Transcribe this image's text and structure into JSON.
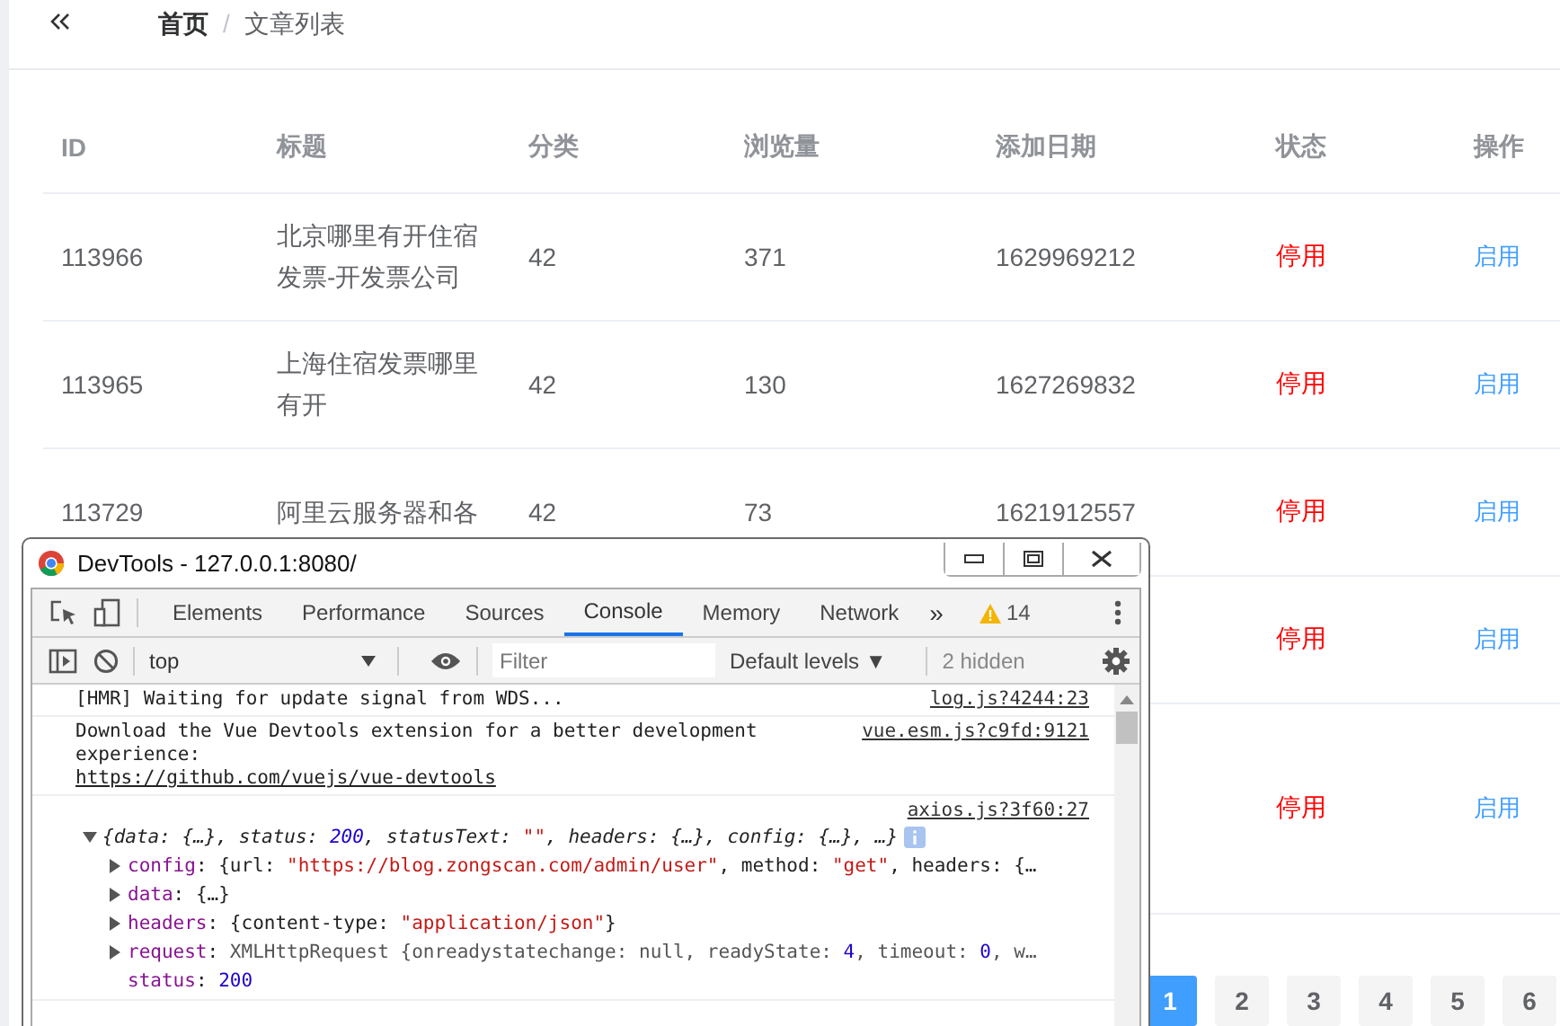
{
  "breadcrumb": [
    {
      "label": "首页",
      "current": false
    },
    {
      "label": "文章列表",
      "current": true
    }
  ],
  "breadcrumb_separator": "/",
  "table": {
    "columns": [
      "ID",
      "标题",
      "分类",
      "浏览量",
      "添加日期",
      "状态",
      "操作"
    ],
    "rows": [
      {
        "id": "113966",
        "title": "北京哪里有开住宿发票-开发票公司",
        "category": "42",
        "views": "371",
        "date": "1629969212",
        "status": "停用",
        "action": "启用"
      },
      {
        "id": "113965",
        "title": "上海住宿发票哪里有开",
        "category": "42",
        "views": "130",
        "date": "1627269832",
        "status": "停用",
        "action": "启用"
      },
      {
        "id": "113729",
        "title": "阿里云服务器和各",
        "category": "42",
        "views": "73",
        "date": "1621912557",
        "status": "停用",
        "action": "启用"
      },
      {
        "status": "停用",
        "action": "启用"
      },
      {
        "status": "停用",
        "action": "启用"
      }
    ]
  },
  "pagination": [
    {
      "label": "1",
      "selected": true
    },
    {
      "label": "2",
      "selected": false
    },
    {
      "label": "3",
      "selected": false
    },
    {
      "label": "4",
      "selected": false
    },
    {
      "label": "5",
      "selected": false
    },
    {
      "label": "6",
      "selected": false
    }
  ],
  "devtools": {
    "title": "DevTools - 127.0.0.1:8080/",
    "tabs": [
      {
        "label": "Elements",
        "selected": false
      },
      {
        "label": "Performance",
        "selected": false
      },
      {
        "label": "Sources",
        "selected": false
      },
      {
        "label": "Console",
        "selected": true
      },
      {
        "label": "Memory",
        "selected": false
      },
      {
        "label": "Network",
        "selected": false
      }
    ],
    "more_tabs": "»",
    "warnings": "14",
    "context": "top",
    "filter_placeholder": "Filter",
    "levels": "Default levels ▼",
    "hidden": "2 hidden",
    "messages": [
      {
        "kind": "log",
        "text": "[HMR] Waiting for update signal from WDS...",
        "source": "log.js?4244:23"
      },
      {
        "kind": "log",
        "text": "Download the Vue Devtools extension for a better development experience:",
        "link": "https://github.com/vuejs/vue-devtools",
        "source": "vue.esm.js?c9fd:9121"
      },
      {
        "kind": "object",
        "source": "axios.js?3f60:27",
        "summary": [
          {
            "t": "{data: {…}, status: ",
            "kind": "plain"
          },
          {
            "t": "200",
            "kind": "number"
          },
          {
            "t": ", statusText: ",
            "kind": "plain"
          },
          {
            "t": "\"\"",
            "kind": "string"
          },
          {
            "t": ", headers: {…}, config: {…}, …}",
            "kind": "plain"
          }
        ],
        "props": [
          {
            "key": "config",
            "expandable": true,
            "value": [
              {
                "t": ": ",
                "kind": "plain"
              },
              {
                "t": "{url: ",
                "kind": "plain"
              },
              {
                "t": "\"https://blog.zongscan.com/admin/user\"",
                "kind": "string"
              },
              {
                "t": ", method: ",
                "kind": "plain"
              },
              {
                "t": "\"get\"",
                "kind": "string"
              },
              {
                "t": ", headers: {…",
                "kind": "plain"
              }
            ]
          },
          {
            "key": "data",
            "expandable": true,
            "value": [
              {
                "t": ": ",
                "kind": "plain"
              },
              {
                "t": "{…}",
                "kind": "plain"
              }
            ]
          },
          {
            "key": "headers",
            "expandable": true,
            "value": [
              {
                "t": ": ",
                "kind": "plain"
              },
              {
                "t": "{content-type: ",
                "kind": "plain"
              },
              {
                "t": "\"application/json\"",
                "kind": "string"
              },
              {
                "t": "}",
                "kind": "plain"
              }
            ]
          },
          {
            "key": "request",
            "expandable": true,
            "value": [
              {
                "t": ": ",
                "kind": "plain"
              },
              {
                "t": "XMLHttpRequest {onreadystatechange: null, readyState: ",
                "kind": "grey"
              },
              {
                "t": "4",
                "kind": "number"
              },
              {
                "t": ", timeout: ",
                "kind": "grey"
              },
              {
                "t": "0",
                "kind": "number"
              },
              {
                "t": ", w…",
                "kind": "grey"
              }
            ]
          },
          {
            "key": "status",
            "expandable": false,
            "value": [
              {
                "t": ": ",
                "kind": "plain"
              },
              {
                "t": "200",
                "kind": "number"
              }
            ]
          }
        ]
      }
    ]
  }
}
